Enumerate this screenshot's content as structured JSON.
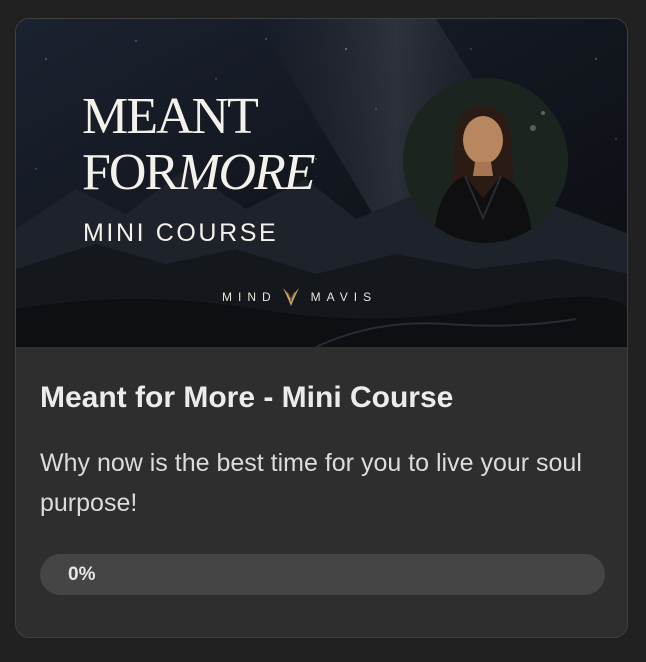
{
  "card": {
    "banner": {
      "title_line1": "MEANT",
      "title_line2_regular": "FOR",
      "title_line2_italic": "MORE",
      "subtitle": "MINI COURSE",
      "brand_left": "MIND",
      "brand_right": "MAVIS",
      "logo_icon": "bird-wings-icon"
    },
    "title": "Meant for More - Mini Course",
    "description": "Why now is the best time for you to live your soul purpose!",
    "progress": {
      "percent": 0,
      "label": "0%"
    }
  },
  "colors": {
    "page_bg": "#212121",
    "card_bg": "#2e2e2e",
    "progress_track": "#454545",
    "text_primary": "#ececec",
    "logo_gold": "#c9a46a"
  }
}
